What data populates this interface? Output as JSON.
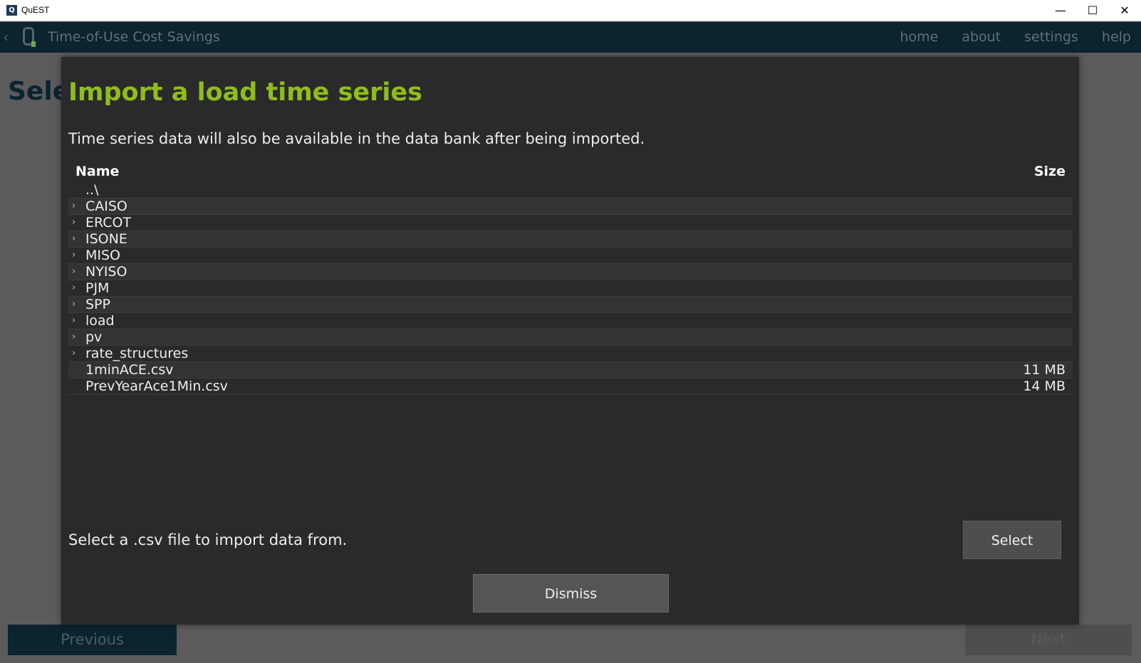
{
  "window": {
    "title": "QuEST",
    "icon_letter": "Q",
    "minimize": "—",
    "maximize": "☐",
    "close": "✕"
  },
  "nav": {
    "back": "‹",
    "title": "Time-of-Use Cost Savings",
    "links": [
      "home",
      "about",
      "settings",
      "help"
    ]
  },
  "background": {
    "heading": "Sele",
    "previous": "Previous",
    "next": "Next"
  },
  "modal": {
    "title": "Import a load time series",
    "description": "Time series data will also be available in the data bank after being imported.",
    "columns": {
      "name": "Name",
      "size": "Size"
    },
    "rows": [
      {
        "name": "..\\",
        "size": "",
        "folder": false
      },
      {
        "name": "CAISO",
        "size": "",
        "folder": true
      },
      {
        "name": "ERCOT",
        "size": "",
        "folder": true
      },
      {
        "name": "ISONE",
        "size": "",
        "folder": true
      },
      {
        "name": "MISO",
        "size": "",
        "folder": true
      },
      {
        "name": "NYISO",
        "size": "",
        "folder": true
      },
      {
        "name": "PJM",
        "size": "",
        "folder": true
      },
      {
        "name": "SPP",
        "size": "",
        "folder": true
      },
      {
        "name": "load",
        "size": "",
        "folder": true
      },
      {
        "name": "pv",
        "size": "",
        "folder": true
      },
      {
        "name": "rate_structures",
        "size": "",
        "folder": true
      },
      {
        "name": "1minACE.csv",
        "size": "11 MB",
        "folder": false
      },
      {
        "name": "PrevYearAce1Min.csv",
        "size": "14 MB",
        "folder": false
      }
    ],
    "hint": "Select a .csv file to import data from.",
    "select_label": "Select",
    "dismiss_label": "Dismiss"
  },
  "colors": {
    "accent": "#8fbd1b",
    "nav_bg": "#0c2330",
    "modal_bg": "#2a2a2a"
  }
}
